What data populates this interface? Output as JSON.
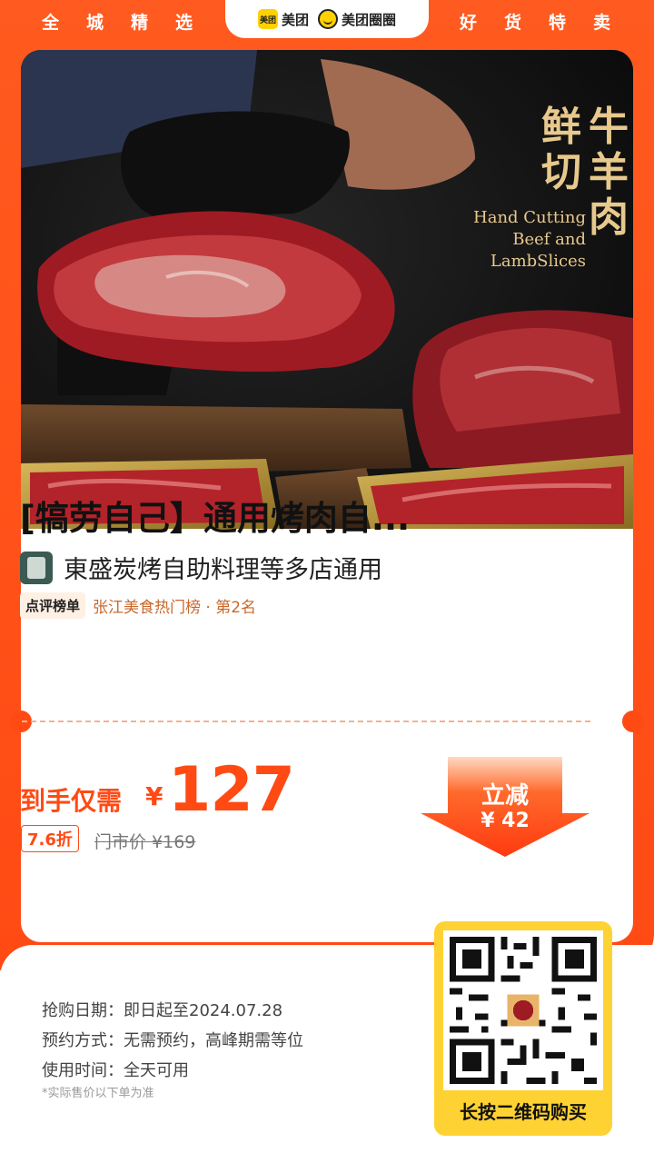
{
  "header": {
    "left_slogan": "全城精选",
    "right_slogan": "好货特卖",
    "brand_meituan": "美团",
    "brand_meituan_logo": "美团",
    "brand_quanquan": "美团圈圈"
  },
  "hero": {
    "title_col1": "鲜切",
    "title_col2": "牛羊肉",
    "english_text": "Hand Cutting Beef and LambSlices"
  },
  "product": {
    "title": "[犒劳自己】通用烤肉自...",
    "shop_name": "東盛炭烤自助料理等多店通用",
    "rank_badge": "点评榜单",
    "rank_text": "张江美食热门榜 · 第2名"
  },
  "price": {
    "label": "到手仅需",
    "currency": "¥",
    "amount": "127",
    "discount": "7.6折",
    "original": "门市价 ¥169",
    "save_label": "立减",
    "save_amount": "¥ 42"
  },
  "info": {
    "purchase_date": "抢购日期：即日起至2024.07.28",
    "reservation": "预约方式：无需预约，高峰期需等位",
    "usage_time": "使用时间：全天可用",
    "note": "*实际售价以下单为准"
  },
  "qr": {
    "label": "长按二维码购买"
  },
  "colors": {
    "brand_orange": "#ff4a14",
    "gold_text": "#e8c98d",
    "qr_yellow": "#ffd233"
  }
}
